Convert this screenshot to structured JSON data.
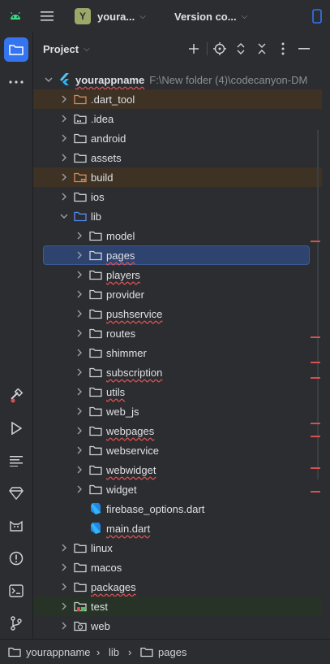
{
  "topbar": {
    "android_icon": "android-icon",
    "menu_icon": "hamburger-menu-icon",
    "project_badge": "Y",
    "project_name": "youra...",
    "vcs_label": "Version co...",
    "device_icon": "device-frame-icon"
  },
  "sidebar": {
    "items": [
      {
        "name": "project-view",
        "icon": "folder-icon",
        "active": true
      },
      {
        "name": "more",
        "icon": "more-horizontal-icon"
      },
      {
        "name": "build",
        "icon": "hammer-icon"
      },
      {
        "name": "run",
        "icon": "play-icon"
      },
      {
        "name": "logcat",
        "icon": "list-lines-icon"
      },
      {
        "name": "app-quality",
        "icon": "diamond-icon"
      },
      {
        "name": "app-inspection",
        "icon": "cat-icon"
      },
      {
        "name": "problems",
        "icon": "alert-circle-icon"
      },
      {
        "name": "terminal",
        "icon": "terminal-icon"
      },
      {
        "name": "version-control",
        "icon": "git-branch-icon"
      }
    ]
  },
  "panel": {
    "title": "Project",
    "tools": [
      "plus-icon",
      "target-icon",
      "expand-icon",
      "collapse-icon",
      "kebab-icon",
      "minimize-icon"
    ]
  },
  "tree": [
    {
      "label": "yourappname",
      "path": "F:\\New folder (4)\\codecanyon-DM",
      "depth": 0,
      "expanded": true,
      "icon": "flutter-icon",
      "err": true
    },
    {
      "label": ".dart_tool",
      "depth": 1,
      "icon": "folder-orange",
      "excluded": true
    },
    {
      "label": ".idea",
      "depth": 1,
      "icon": "folder-dots"
    },
    {
      "label": "android",
      "depth": 1,
      "icon": "folder"
    },
    {
      "label": "assets",
      "depth": 1,
      "icon": "folder"
    },
    {
      "label": "build",
      "depth": 1,
      "icon": "folder-orange-dots",
      "excluded": true
    },
    {
      "label": "ios",
      "depth": 1,
      "icon": "folder"
    },
    {
      "label": "lib",
      "depth": 1,
      "icon": "folder-blue",
      "expanded": true
    },
    {
      "label": "model",
      "depth": 2,
      "icon": "folder"
    },
    {
      "label": "pages",
      "depth": 2,
      "icon": "folder",
      "selected": true,
      "err": true
    },
    {
      "label": "players",
      "depth": 2,
      "icon": "folder",
      "err": true
    },
    {
      "label": "provider",
      "depth": 2,
      "icon": "folder"
    },
    {
      "label": "pushservice",
      "depth": 2,
      "icon": "folder",
      "err": true
    },
    {
      "label": "routes",
      "depth": 2,
      "icon": "folder"
    },
    {
      "label": "shimmer",
      "depth": 2,
      "icon": "folder"
    },
    {
      "label": "subscription",
      "depth": 2,
      "icon": "folder",
      "err": true
    },
    {
      "label": "utils",
      "depth": 2,
      "icon": "folder",
      "err": true
    },
    {
      "label": "web_js",
      "depth": 2,
      "icon": "folder"
    },
    {
      "label": "webpages",
      "depth": 2,
      "icon": "folder",
      "err": true
    },
    {
      "label": "webservice",
      "depth": 2,
      "icon": "folder"
    },
    {
      "label": "webwidget",
      "depth": 2,
      "icon": "folder",
      "err": true
    },
    {
      "label": "widget",
      "depth": 2,
      "icon": "folder"
    },
    {
      "label": "firebase_options.dart",
      "depth": 2,
      "icon": "dart-file",
      "leaf": true
    },
    {
      "label": "main.dart",
      "depth": 2,
      "icon": "dart-file",
      "leaf": true,
      "err": true
    },
    {
      "label": "linux",
      "depth": 1,
      "icon": "folder"
    },
    {
      "label": "macos",
      "depth": 1,
      "icon": "folder"
    },
    {
      "label": "packages",
      "depth": 1,
      "icon": "folder",
      "err": true
    },
    {
      "label": "test",
      "depth": 1,
      "icon": "folder-test",
      "test": true
    },
    {
      "label": "web",
      "depth": 1,
      "icon": "folder-web"
    }
  ],
  "breadcrumb": [
    "yourappname",
    "lib",
    "pages"
  ],
  "colors": {
    "accent": "#3574f0",
    "error": "#d95050",
    "excluded_bg": "#3d3223",
    "test_bg": "#263326",
    "selected_bg": "#2e436e",
    "badge": "#9aa86a"
  }
}
